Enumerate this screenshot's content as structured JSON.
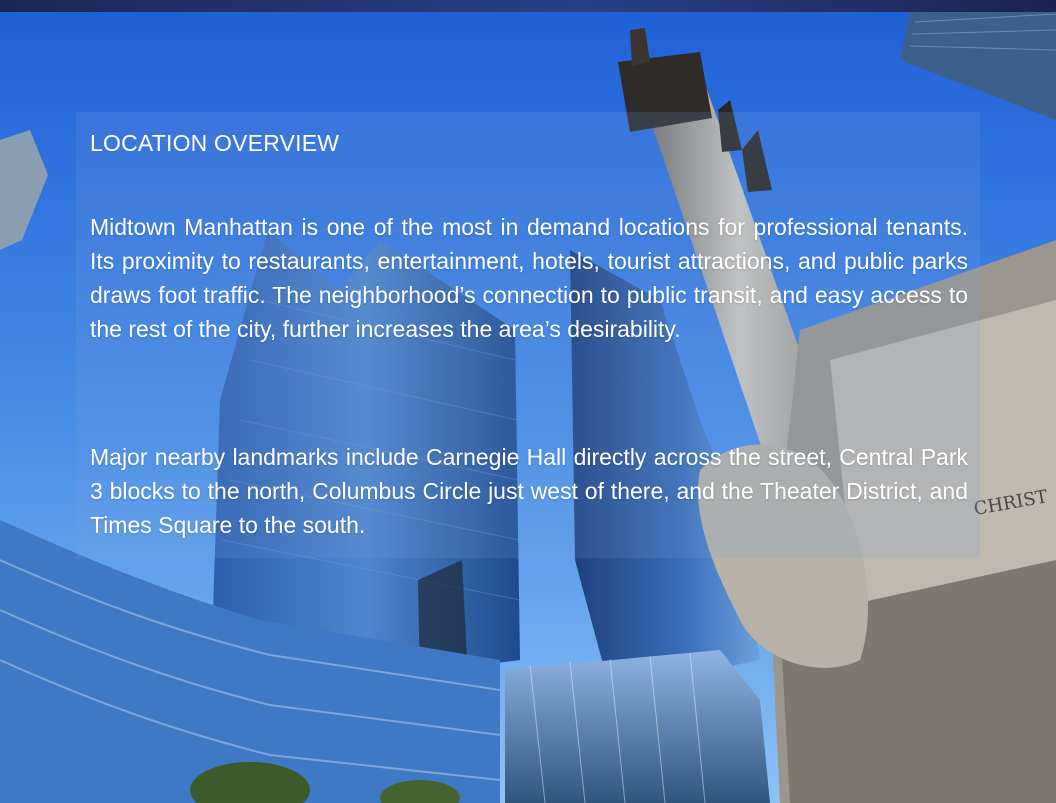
{
  "slide": {
    "heading": "LOCATION OVERVIEW",
    "paragraphs": [
      "Midtown Manhattan is one of the most in demand locations for professional tenants. Its proximity to restaurants, entertainment, hotels, tourist attractions, and public parks draws foot traffic. The neighborhood’s connection to public transit, and easy access to the rest of the city, further increases the area’s desirability.",
      "Major nearby landmarks include Carnegie Hall directly across the street, Central Park 3 blocks to the north, Columbus Circle just west of there, and the Theater District, and Times Square to the south."
    ],
    "statue_inscription": "CHRIST"
  },
  "colors": {
    "sky_top": "#1f63d8",
    "sky_bottom": "#6fb0f0",
    "glass_tower": "#2a5ea8",
    "stone": "#b9b3a8",
    "top_band": "#22306a"
  }
}
